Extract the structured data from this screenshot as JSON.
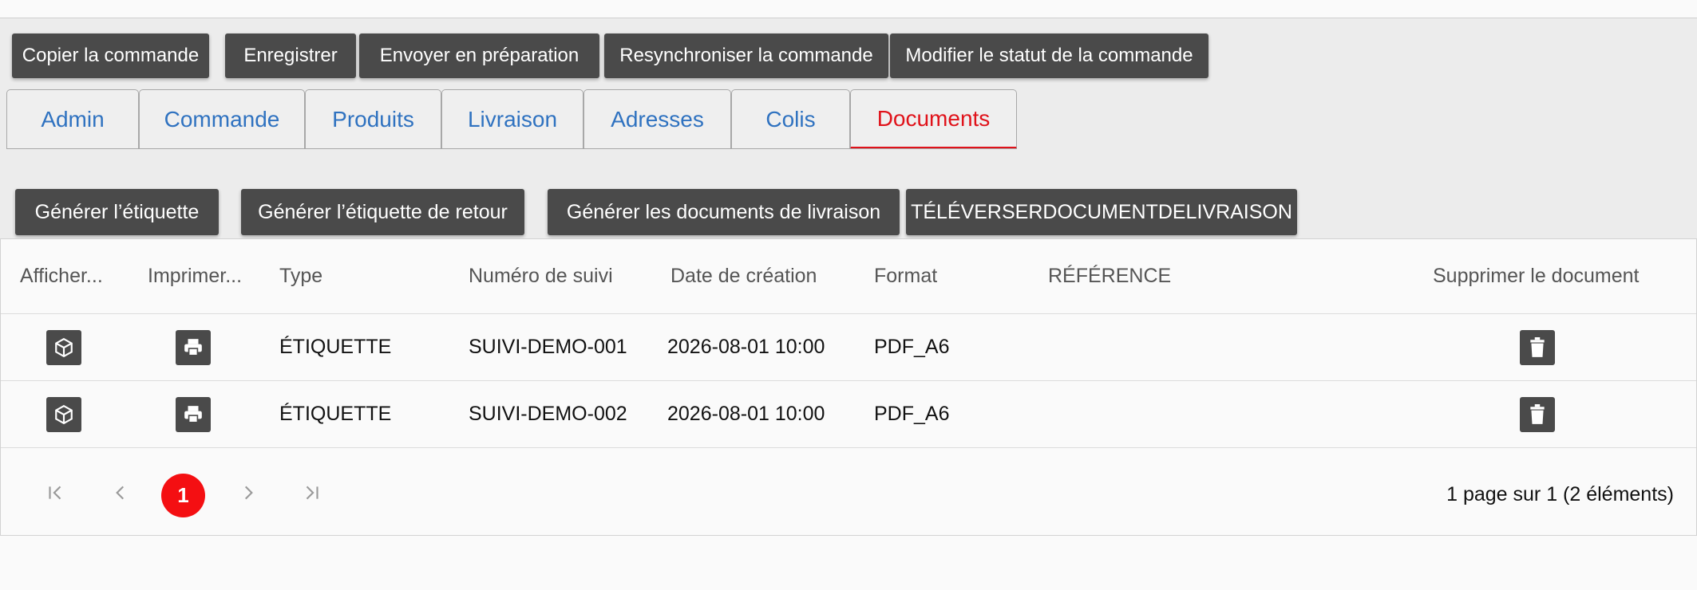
{
  "toolbar": {
    "copy_order": "Copier la commande",
    "save": "Enregistrer",
    "send_prep": "Envoyer en préparation",
    "resync": "Resynchroniser la commande",
    "change_status": "Modifier le statut de la commande"
  },
  "tabs": [
    {
      "label": "Admin"
    },
    {
      "label": "Commande"
    },
    {
      "label": "Produits"
    },
    {
      "label": "Livraison"
    },
    {
      "label": "Adresses"
    },
    {
      "label": "Colis"
    },
    {
      "label": "Documents",
      "active": true
    }
  ],
  "documents_toolbar": {
    "gen_label": "Générer l’étiquette",
    "gen_return": "Générer l’étiquette de retour",
    "gen_docs": "Générer les documents de livraison",
    "upload": "TÉLÉVERSERDOCUMENTDELIVRAISON"
  },
  "table": {
    "headers": {
      "show": "Afficher...",
      "print": "Imprimer...",
      "type": "Type",
      "tracking": "Numéro de suivi",
      "created": "Date de création",
      "format": "Format",
      "reference": "RÉFÉRENCE",
      "delete": "Supprimer le document"
    },
    "rows": [
      {
        "type": "ÉTIQUETTE",
        "tracking": "SUIVI-DEMO-001",
        "created": "2026-08-01 10:00",
        "format": "PDF_A6",
        "reference": ""
      },
      {
        "type": "ÉTIQUETTE",
        "tracking": "SUIVI-DEMO-002",
        "created": "2026-08-01 10:00",
        "format": "PDF_A6",
        "reference": ""
      }
    ]
  },
  "pager": {
    "current_page": "1",
    "info": "1 page sur 1 (2 éléments)"
  },
  "colors": {
    "button_bg": "#4a4a4a",
    "tab_text": "#2f72c0",
    "active_tab": "#e0121a",
    "page_current": "#f40f12"
  },
  "icons": {
    "show": "package-icon",
    "print": "printer-icon",
    "delete": "trash-icon"
  }
}
